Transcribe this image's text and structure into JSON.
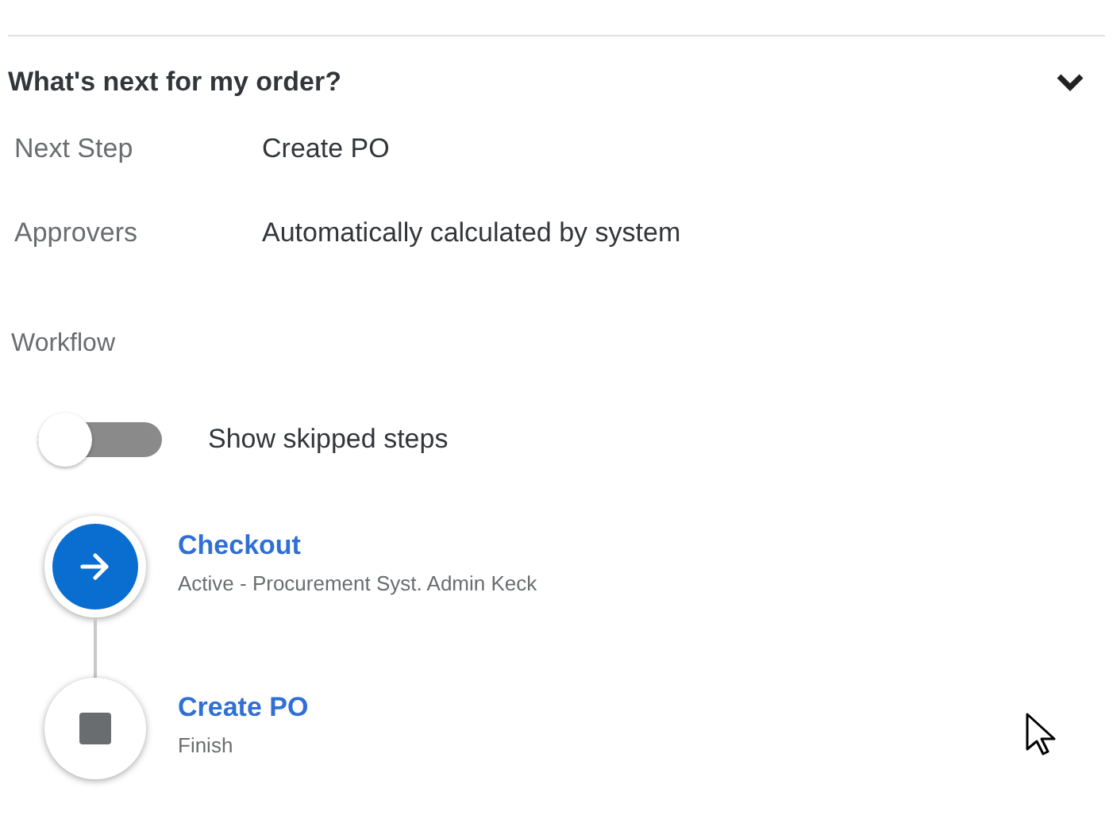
{
  "section": {
    "title": "What's next for my order?",
    "expanded": true
  },
  "fields": [
    {
      "label": "Next Step",
      "value": "Create PO"
    },
    {
      "label": "Approvers",
      "value": "Automatically calculated by system"
    }
  ],
  "workflow": {
    "label": "Workflow",
    "toggle": {
      "label": "Show skipped steps",
      "on": false
    },
    "steps": [
      {
        "kind": "active",
        "title": "Checkout",
        "subtitle": "Active - Procurement Syst. Admin Keck"
      },
      {
        "kind": "finish",
        "title": "Create PO",
        "subtitle": "Finish"
      }
    ]
  }
}
